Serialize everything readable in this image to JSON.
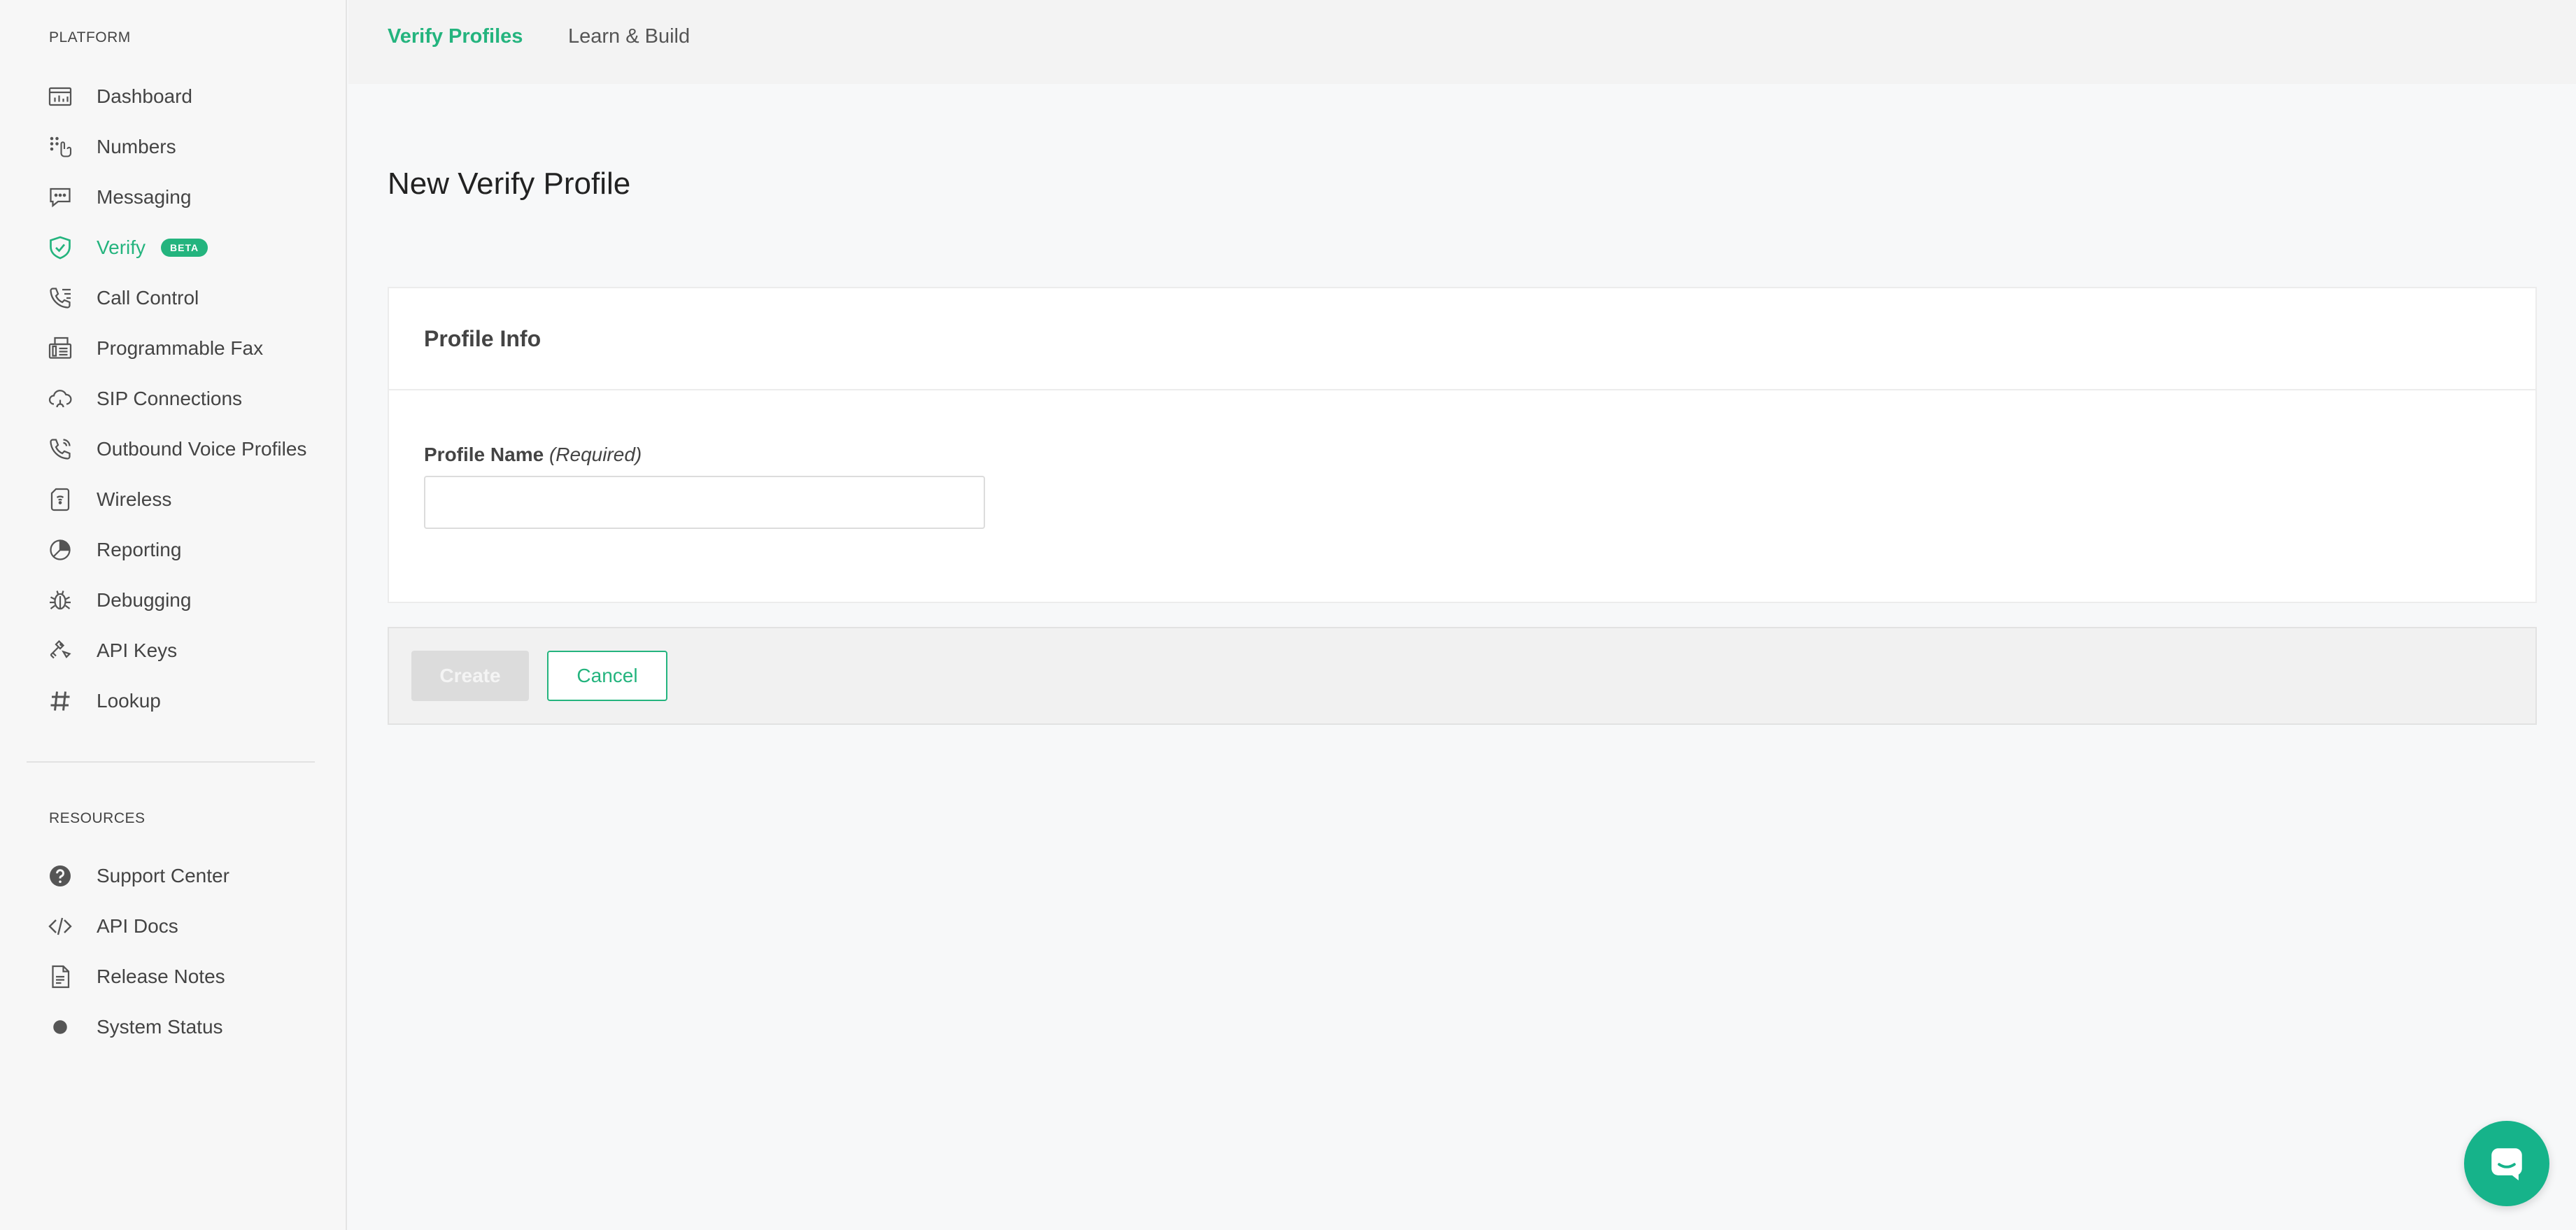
{
  "sidebar": {
    "platform_title": "PLATFORM",
    "resources_title": "RESOURCES",
    "platform_items": [
      {
        "label": "Dashboard",
        "icon": "dashboard-icon"
      },
      {
        "label": "Numbers",
        "icon": "numbers-icon"
      },
      {
        "label": "Messaging",
        "icon": "messaging-icon"
      },
      {
        "label": "Verify",
        "icon": "shield-check-icon",
        "badge": "BETA",
        "active": true
      },
      {
        "label": "Call Control",
        "icon": "call-control-icon"
      },
      {
        "label": "Programmable Fax",
        "icon": "fax-icon"
      },
      {
        "label": "SIP Connections",
        "icon": "sip-cloud-icon"
      },
      {
        "label": "Outbound Voice Profiles",
        "icon": "outbound-phone-icon"
      },
      {
        "label": "Wireless",
        "icon": "sim-card-icon"
      },
      {
        "label": "Reporting",
        "icon": "pie-chart-icon"
      },
      {
        "label": "Debugging",
        "icon": "bug-icon"
      },
      {
        "label": "API Keys",
        "icon": "key-icon"
      },
      {
        "label": "Lookup",
        "icon": "hash-icon"
      }
    ],
    "resource_items": [
      {
        "label": "Support Center",
        "icon": "question-circle-icon"
      },
      {
        "label": "API Docs",
        "icon": "code-icon"
      },
      {
        "label": "Release Notes",
        "icon": "document-icon"
      },
      {
        "label": "System Status",
        "icon": "status-dot-icon"
      }
    ]
  },
  "topbar": {
    "tabs": [
      {
        "label": "Verify Profiles",
        "active": true
      },
      {
        "label": "Learn & Build",
        "active": false
      }
    ]
  },
  "main": {
    "page_title": "New Verify Profile",
    "card_title": "Profile Info",
    "field_label": "Profile Name",
    "field_required": "(Required)",
    "field_value": "",
    "field_placeholder": "",
    "create_label": "Create",
    "cancel_label": "Cancel"
  },
  "colors": {
    "accent": "#24b47e",
    "chat": "#16b38a"
  }
}
